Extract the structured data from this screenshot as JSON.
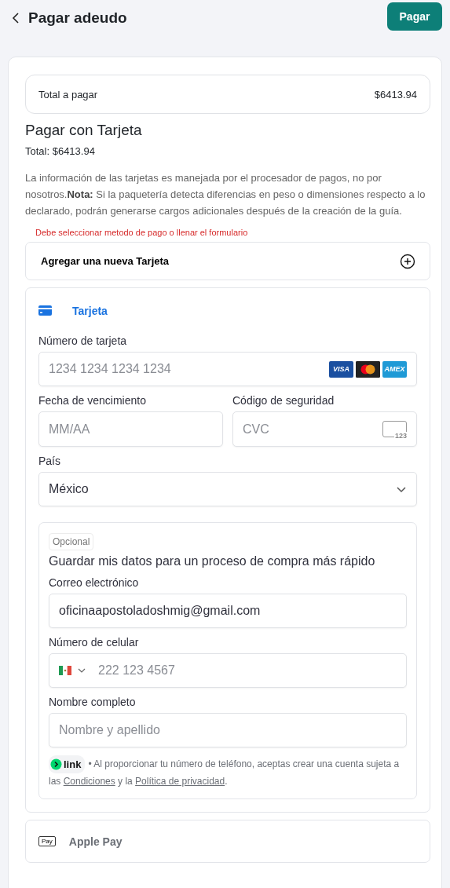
{
  "header": {
    "title": "Pagar adeudo",
    "action": "Pagar"
  },
  "total_bar": {
    "label": "Total a pagar",
    "amount": "$6413.94"
  },
  "payment": {
    "title": "Pagar con Tarjeta",
    "total": "Total: $6413.94",
    "notice": "La información de las tarjetas es manejada por el procesador de pagos, no por nosotros.**Nota:** Si la paquetería detecta diferencias en peso o dimensiones respecto a lo declarado, podrán generarse cargos adicionales después de la creación de la guía.",
    "error": "Debe seleccionar metodo de pago o llenar el formulario",
    "add_card": "Agregar una nueva Tarjeta"
  },
  "methods": [
    {
      "kind": "card",
      "label": "Tarjeta",
      "selected": true
    },
    {
      "kind": "apple_pay",
      "label": "Apple Pay",
      "logo_text": "Pay",
      "selected": false
    }
  ],
  "card_form": {
    "number": {
      "label": "Número de tarjeta",
      "placeholder": "1234 1234 1234 1234",
      "brands": [
        {
          "kind": "visa",
          "text": "VISA"
        },
        {
          "kind": "mastercard"
        },
        {
          "kind": "amex",
          "text": "AMEX"
        }
      ]
    },
    "expiry": {
      "label": "Fecha de vencimiento",
      "placeholder": "MM/AA"
    },
    "cvc": {
      "label": "Código de seguridad",
      "placeholder": "CVC",
      "icon_text": "123"
    },
    "country": {
      "label": "País",
      "value": "México"
    }
  },
  "link_section": {
    "badge": "Opcional",
    "heading": "Guardar mis datos para un proceso de compra más rápido",
    "email": {
      "label": "Correo electrónico",
      "value": "oficinaapostoladoshmig@gmail.com"
    },
    "phone": {
      "label": "Número de celular",
      "placeholder": "222 123 4567"
    },
    "name": {
      "label": "Nombre completo",
      "placeholder": "Nombre y apellido"
    },
    "logo_text": "link",
    "legal": {
      "before": "• Al proporcionar tu número de teléfono, aceptas crear una cuenta sujeta a las",
      "link_1": "Condiciones",
      "middle": "y la",
      "link_2": "Política de privacidad",
      "after": "."
    }
  }
}
